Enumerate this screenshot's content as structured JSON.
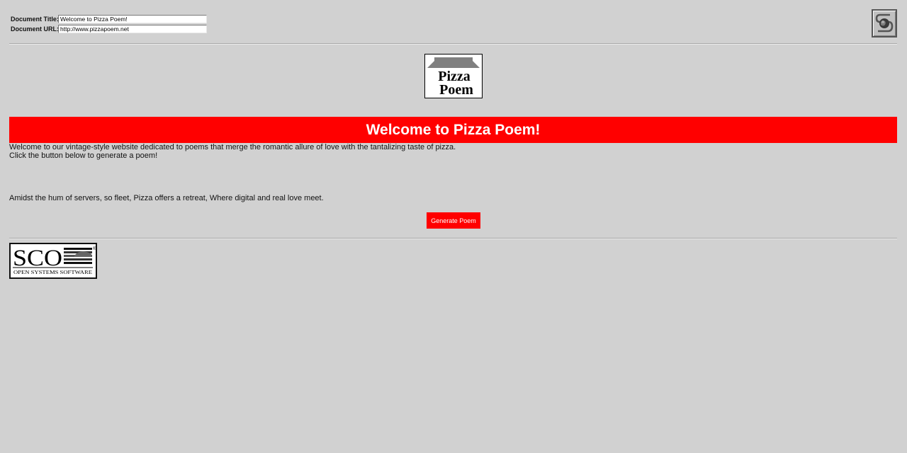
{
  "header": {
    "title_label": "Document Title:",
    "title_value": "Welcome to Pizza Poem!",
    "url_label": "Document URL:",
    "url_value": "http://www.pizzapoem.net",
    "globe_icon": "globe-navigation-icon"
  },
  "logo": {
    "line1": "Pizza",
    "line2": "Poem",
    "roof_color": "#808080"
  },
  "main": {
    "heading": "Welcome to Pizza Poem!",
    "intro_line1": "Welcome to our vintage-style website dedicated to poems that merge the romantic allure of love with the tantalizing taste of pizza.",
    "intro_line2": "Click the button below to generate a poem!",
    "poem": "Amidst the hum of servers, so fleet, Pizza offers a retreat, Where digital and real love meet.",
    "button_label": "Generate Poem",
    "accent_color": "#ff0000"
  },
  "footer": {
    "badge_brand": "SCO",
    "badge_tagline": "OPEN SYSTEMS SOFTWARE",
    "badge_mark": "®"
  }
}
